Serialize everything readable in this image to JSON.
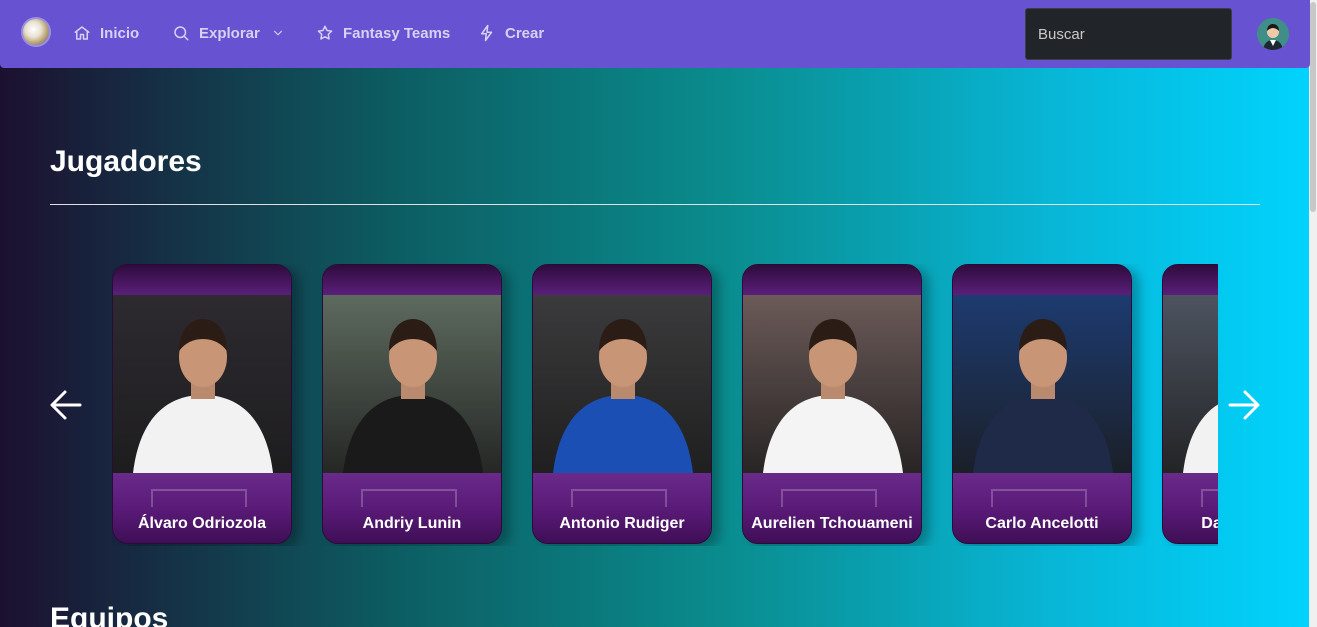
{
  "navbar": {
    "items": [
      {
        "label": "Inicio",
        "icon": "home-icon"
      },
      {
        "label": "Explorar",
        "icon": "search-icon",
        "dropdown": true
      },
      {
        "label": "Fantasy Teams",
        "icon": "star-icon"
      },
      {
        "label": "Crear",
        "icon": "bolt-icon"
      }
    ],
    "search_placeholder": "Buscar",
    "accent": "#6752d1"
  },
  "players_section": {
    "title": "Jugadores",
    "cards": [
      {
        "name": "Álvaro Odriozola",
        "kit": "#f2f2f2",
        "bg": "#2d2a30"
      },
      {
        "name": "Andriy Lunin",
        "kit": "#1a1a1a",
        "bg": "#5d6a5e"
      },
      {
        "name": "Antonio Rudiger",
        "kit": "#1c4fb4",
        "bg": "#3b3a3c"
      },
      {
        "name": "Aurelien Tchouameni",
        "kit": "#f4f4f4",
        "bg": "#6b5a58"
      },
      {
        "name": "Carlo Ancelotti",
        "kit": "#1f2a48",
        "bg": "#1d3b70"
      },
      {
        "name": "Dani Carvajal",
        "kit": "#f2f2f2",
        "bg": "#4d5460"
      }
    ]
  },
  "teams_section": {
    "title": "Equipos"
  }
}
